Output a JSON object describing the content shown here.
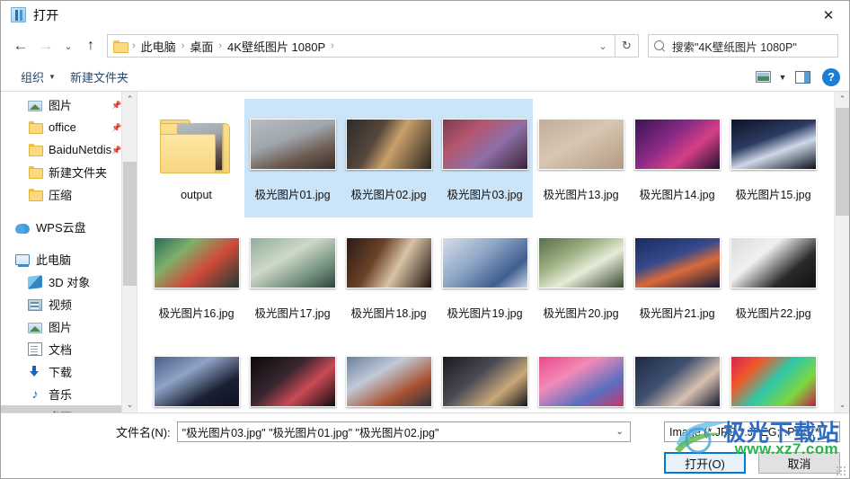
{
  "window": {
    "title": "打开",
    "close_label": "✕",
    "title_icon": "app-window-icon"
  },
  "address_bar": {
    "back_icon": "←",
    "forward_icon": "→",
    "history_icon": "⌄",
    "up_icon": "↑",
    "breadcrumbs": [
      "此电脑",
      "桌面",
      "4K壁纸图片 1080P"
    ],
    "separator": "›",
    "dropdown_icon": "⌄",
    "refresh_icon": "↻",
    "search_placeholder": "搜索\"4K壁纸图片 1080P\"",
    "search_value": "",
    "search_icon": "search-icon"
  },
  "command_bar": {
    "organize_label": "组织",
    "organize_caret": "▼",
    "new_folder_label": "新建文件夹",
    "view_caret": "▼",
    "help_label": "?"
  },
  "sidebar": {
    "items": [
      {
        "label": "图片",
        "icon": "picture-icon",
        "pinned": true,
        "indent": "indent2",
        "selected": false
      },
      {
        "label": "office",
        "icon": "folder-icon",
        "pinned": true,
        "indent": "indent2",
        "selected": false
      },
      {
        "label": "BaiduNetdis",
        "icon": "folder-icon",
        "pinned": true,
        "indent": "indent2",
        "selected": false
      },
      {
        "label": "新建文件夹",
        "icon": "folder-icon",
        "pinned": false,
        "indent": "indent2",
        "selected": false
      },
      {
        "label": "压缩",
        "icon": "folder-icon",
        "pinned": false,
        "indent": "indent2",
        "selected": false
      },
      {
        "gap": true
      },
      {
        "label": "WPS云盘",
        "icon": "cloud-icon",
        "pinned": false,
        "indent": "root",
        "selected": false
      },
      {
        "gap": true
      },
      {
        "label": "此电脑",
        "icon": "computer-icon",
        "pinned": false,
        "indent": "root",
        "selected": false
      },
      {
        "label": "3D 对象",
        "icon": "cube-icon",
        "pinned": false,
        "indent": "indent2",
        "selected": false
      },
      {
        "label": "视频",
        "icon": "video-icon",
        "pinned": false,
        "indent": "indent2",
        "selected": false
      },
      {
        "label": "图片",
        "icon": "picture-icon",
        "pinned": false,
        "indent": "indent2",
        "selected": false
      },
      {
        "label": "文档",
        "icon": "document-icon",
        "pinned": false,
        "indent": "indent2",
        "selected": false
      },
      {
        "label": "下载",
        "icon": "download-icon",
        "pinned": false,
        "indent": "indent2",
        "selected": false
      },
      {
        "label": "音乐",
        "icon": "music-icon",
        "pinned": false,
        "indent": "indent2",
        "selected": false
      },
      {
        "label": "桌面",
        "icon": "desktop-icon",
        "pinned": false,
        "indent": "indent2",
        "selected": true
      }
    ],
    "scroll_up_icon": "⌃",
    "scroll_down_icon": "⌄"
  },
  "files": [
    {
      "name": "output",
      "type": "folder",
      "selected": false
    },
    {
      "name": "极光图片01.jpg",
      "type": "image",
      "selected": true
    },
    {
      "name": "极光图片02.jpg",
      "type": "image",
      "selected": true
    },
    {
      "name": "极光图片03.jpg",
      "type": "image",
      "selected": true
    },
    {
      "name": "极光图片13.jpg",
      "type": "image",
      "selected": false
    },
    {
      "name": "极光图片14.jpg",
      "type": "image",
      "selected": false
    },
    {
      "name": "极光图片15.jpg",
      "type": "image",
      "selected": false
    },
    {
      "name": "极光图片16.jpg",
      "type": "image",
      "selected": false
    },
    {
      "name": "极光图片17.jpg",
      "type": "image",
      "selected": false
    },
    {
      "name": "极光图片18.jpg",
      "type": "image",
      "selected": false
    },
    {
      "name": "极光图片19.jpg",
      "type": "image",
      "selected": false
    },
    {
      "name": "极光图片20.jpg",
      "type": "image",
      "selected": false
    },
    {
      "name": "极光图片21.jpg",
      "type": "image",
      "selected": false
    },
    {
      "name": "极光图片22.jpg",
      "type": "image",
      "selected": false
    },
    {
      "name": "",
      "type": "image",
      "selected": false
    },
    {
      "name": "",
      "type": "image",
      "selected": false
    },
    {
      "name": "",
      "type": "image",
      "selected": false
    },
    {
      "name": "",
      "type": "image",
      "selected": false
    },
    {
      "name": "",
      "type": "image",
      "selected": false
    },
    {
      "name": "",
      "type": "image",
      "selected": false
    },
    {
      "name": "",
      "type": "image",
      "selected": false
    }
  ],
  "footer": {
    "filename_label": "文件名(N):",
    "filename_value": "\"极光图片03.jpg\" \"极光图片01.jpg\" \"极光图片02.jpg\"",
    "filename_caret": "⌄",
    "filetype_value": "Image (*.JPG;*.JPEG;*.PNG;*.(",
    "filetype_caret": "⌄",
    "open_button": "打开(O)",
    "cancel_button": "取消"
  },
  "watermark": {
    "title": "极光下载站",
    "url": "www.xz7.com"
  },
  "colors": {
    "selection": "#cce4f7",
    "accent": "#0078d7",
    "sidebar_selected": "#cfcfcf",
    "watermark_blue": "#2f6cc0",
    "watermark_green": "#2bb24c"
  }
}
